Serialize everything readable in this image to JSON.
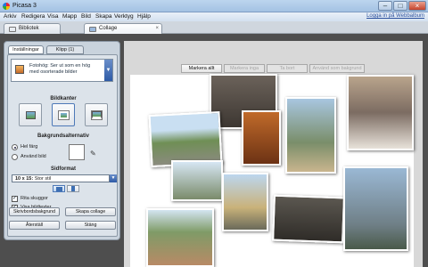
{
  "window": {
    "title": "Picasa 3",
    "min": "–",
    "max": "□",
    "close": "×"
  },
  "menu": {
    "items": [
      "Arkiv",
      "Redigera",
      "Visa",
      "Mapp",
      "Bild",
      "Skapa",
      "Verktyg",
      "Hjälp"
    ],
    "login": "Logga in på Webbalbum"
  },
  "tabs": [
    {
      "label": "Bibliotek"
    },
    {
      "label": "Collage",
      "close": "×"
    }
  ],
  "panel": {
    "tabs": [
      "Inställningar",
      "Klipp (1)"
    ],
    "theme_text": "Fotohög: Ser ut som en hög med osorterade bilder",
    "border_heading": "Bildkanter",
    "bg_heading": "Bakgrundsalternativ",
    "bg_options": [
      "Hel färg",
      "Använd bild"
    ],
    "format_heading": "Sidformat",
    "format_value": "10 x 15:",
    "format_sub": "Stor stil",
    "checkboxes": [
      "Rita skuggor",
      "Visa bildtexter"
    ],
    "check_mark": "✓",
    "buttons": [
      "Skrivbordsbakgrund",
      "Skapa collage",
      "Återställ",
      "Stäng"
    ]
  },
  "canvas_toolbar": {
    "buttons": [
      "Markera allt",
      "Markera inga",
      "Ta bort",
      "Använd som bakgrund"
    ]
  }
}
